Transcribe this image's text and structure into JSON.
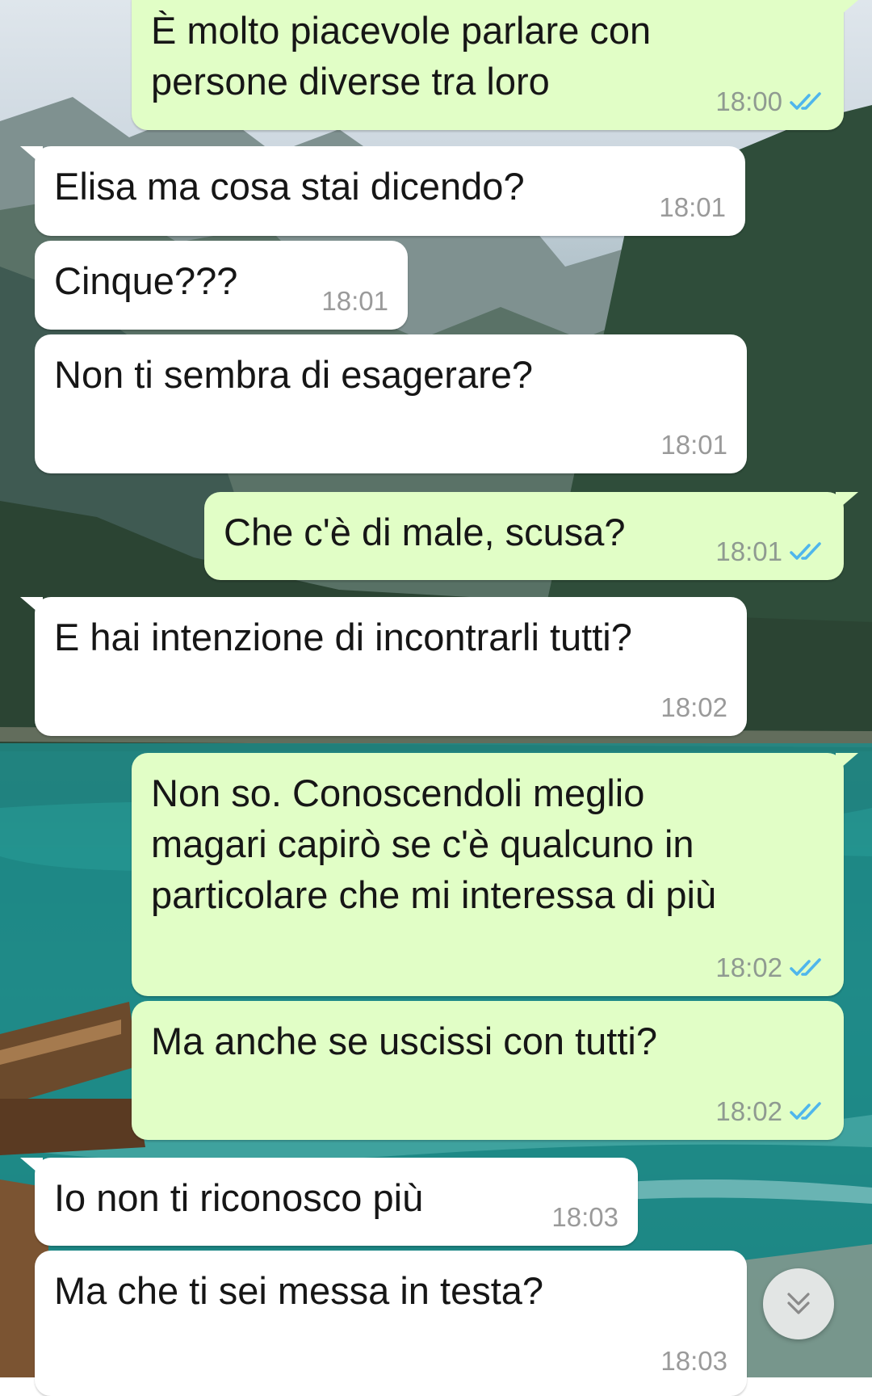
{
  "conversation": {
    "messages": [
      {
        "direction": "out",
        "text": "È molto piacevole parlare con\npersone diverse tra loro",
        "time": "18:00",
        "read": true
      },
      {
        "direction": "in",
        "text": "Elisa ma cosa stai dicendo?",
        "time": "18:01"
      },
      {
        "direction": "in",
        "text": "Cinque???",
        "time": "18:01"
      },
      {
        "direction": "in",
        "text": "Non ti sembra di esagerare?",
        "time": "18:01"
      },
      {
        "direction": "out",
        "text": "Che c'è di male, scusa?",
        "time": "18:01",
        "read": true
      },
      {
        "direction": "in",
        "text": "E hai intenzione di incontrarli tutti?",
        "time": "18:02"
      },
      {
        "direction": "out",
        "text": "Non so. Conoscendoli meglio\nmagari capirò se c'è qualcuno in\nparticolare che mi interessa di più",
        "time": "18:02",
        "read": true
      },
      {
        "direction": "out",
        "text": "Ma anche se uscissi con tutti?",
        "time": "18:02",
        "read": true
      },
      {
        "direction": "in",
        "text": "Io non ti riconosco più",
        "time": "18:03"
      },
      {
        "direction": "in",
        "text": "Ma che ti sei messa in testa?",
        "time": "18:03"
      }
    ]
  },
  "icons": {
    "read_receipt": "double-check-icon",
    "scroll_down": "double-chevron-down-icon"
  },
  "colors": {
    "outgoing_bubble": "#e1fec6",
    "incoming_bubble": "#ffffff",
    "read_ticks": "#4fb6ec"
  }
}
